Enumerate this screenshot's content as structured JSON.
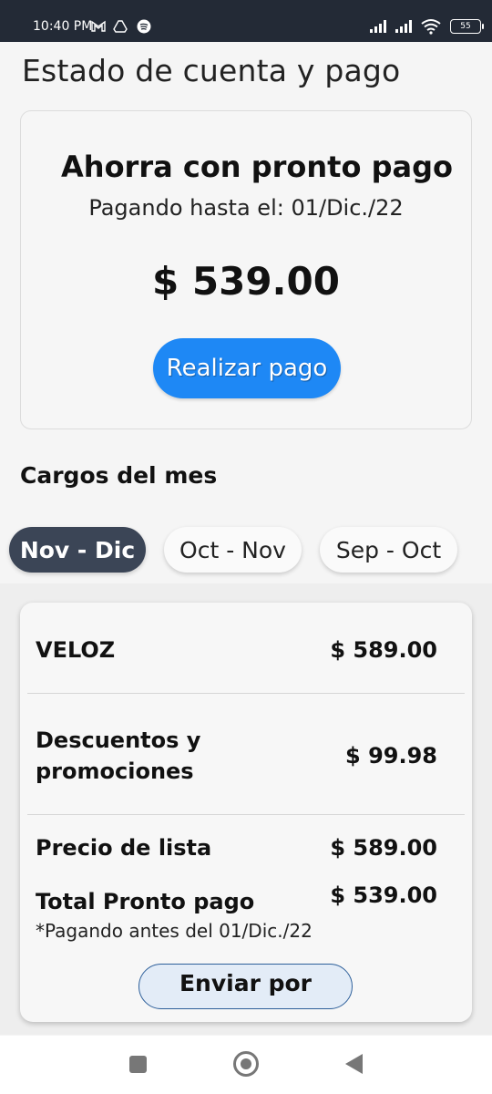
{
  "status_bar": {
    "time": "10:40 PM",
    "battery": "55",
    "left_icons": [
      "gmail-icon",
      "drive-icon",
      "spotify-icon"
    ],
    "right_icons": [
      "signal-icon",
      "signal-icon",
      "wifi-icon",
      "battery-icon"
    ]
  },
  "page": {
    "title": "Estado de cuenta y pago"
  },
  "promo": {
    "title": "Ahorra con pronto pago",
    "subtitle": "Pagando hasta el: 01/Dic./22",
    "amount": "$ 539.00",
    "pay_button": "Realizar pago"
  },
  "charges": {
    "section_title": "Cargos del mes",
    "tabs": [
      {
        "label": "Nov - Dic",
        "active": true
      },
      {
        "label": "Oct - Nov",
        "active": false
      },
      {
        "label": "Sep - Oct",
        "active": false
      }
    ],
    "rows": [
      {
        "label": "VELOZ",
        "value": "$ 589.00"
      },
      {
        "label": "Descuentos y promociones",
        "value": "$ 99.98"
      },
      {
        "label": "Precio de lista",
        "value": "$ 589.00"
      },
      {
        "label": "Total Pronto pago",
        "value": "$ 539.00"
      }
    ],
    "footnote": "*Pagando antes del 01/Dic./22",
    "email_button": "Enviar por correo"
  },
  "colors": {
    "primary_button": "#1e88f5",
    "active_tab": "#3b4556",
    "status_bar": "#232a36"
  }
}
